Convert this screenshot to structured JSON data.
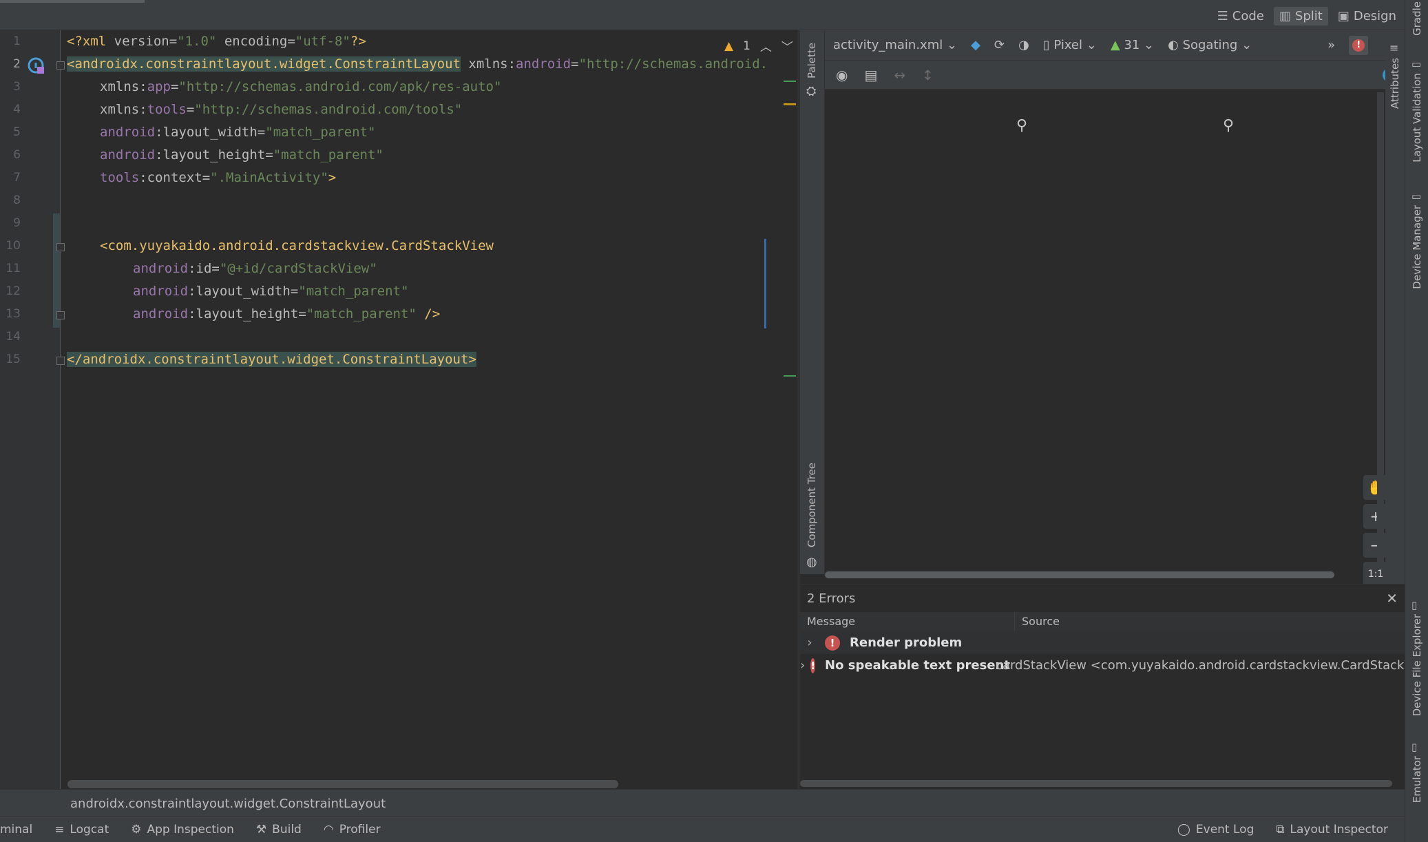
{
  "view_modes": [
    {
      "label": "Code",
      "icon": "lines-icon",
      "active": false
    },
    {
      "label": "Split",
      "icon": "split-icon",
      "active": true
    },
    {
      "label": "Design",
      "icon": "image-icon",
      "active": false
    }
  ],
  "editor": {
    "line_numbers": [
      "1",
      "2",
      "3",
      "4",
      "5",
      "6",
      "7",
      "8",
      "9",
      "10",
      "11",
      "12",
      "13",
      "14",
      "15"
    ],
    "current_line": "2",
    "warning_count": "1",
    "lines": {
      "l1": {
        "open": "<?xml ",
        "a1": "version",
        "eq1": "=",
        "v1": "\"1.0\"",
        "sp": " ",
        "a2": "encoding",
        "eq2": "=",
        "v2": "\"utf-8\"",
        "close": "?>"
      },
      "l2": {
        "tag": "<androidx.constraintlayout.widget.ConstraintLayout",
        "sp": " ",
        "a1": "xmlns:",
        "ns": "android",
        "eq": "=",
        "v": "\"http://schemas.android."
      },
      "l3": {
        "a": "xmlns:",
        "ns": "app",
        "eq": "=",
        "v": "\"http://schemas.android.com/apk/res-auto\""
      },
      "l4": {
        "a": "xmlns:",
        "ns": "tools",
        "eq": "=",
        "v": "\"http://schemas.android.com/tools\""
      },
      "l5": {
        "ns": "android",
        "a": ":layout_width",
        "eq": "=",
        "v": "\"match_parent\""
      },
      "l6": {
        "ns": "android",
        "a": ":layout_height",
        "eq": "=",
        "v": "\"match_parent\""
      },
      "l7": {
        "ns": "tools",
        "a": ":context",
        "eq": "=",
        "v": "\".MainActivity\"",
        "close": ">"
      },
      "l10": {
        "tag": "<com.yuyakaido.android.cardstackview.CardStackView"
      },
      "l11": {
        "ns": "android",
        "a": ":id",
        "eq": "=",
        "v": "\"@+id/cardStackView\""
      },
      "l12": {
        "ns": "android",
        "a": ":layout_width",
        "eq": "=",
        "v": "\"match_parent\""
      },
      "l13": {
        "ns": "android",
        "a": ":layout_height",
        "eq": "=",
        "v": "\"match_parent\"",
        "close": " />"
      },
      "l15": {
        "tag": "</androidx.constraintlayout.widget.ConstraintLayout>"
      }
    }
  },
  "design": {
    "side_palette": {
      "palette": "Palette",
      "component_tree": "Component Tree"
    },
    "toolbar": {
      "file": "activity_main.xml",
      "device": "Pixel",
      "api": "31",
      "theme": "Sogating"
    }
  },
  "errors_panel": {
    "title": "2 Errors",
    "col_message": "Message",
    "col_source": "Source",
    "rows": [
      {
        "message": "Render problem",
        "source": ""
      },
      {
        "message": "No speakable text present",
        "source": "cardStackView <com.yuyakaido.android.cardstackview.CardStackView"
      }
    ]
  },
  "right_strip": {
    "gradle": "Gradle",
    "attributes": "Attributes",
    "layout_validation": "Layout Validation",
    "device_manager": "Device Manager",
    "device_file_explorer": "Device File Explorer",
    "emulator": "Emulator"
  },
  "breadcrumb": "androidx.constraintlayout.widget.ConstraintLayout",
  "bottom_tabs": {
    "terminal": "minal",
    "logcat": "Logcat",
    "app_inspection": "App Inspection",
    "build": "Build",
    "profiler": "Profiler",
    "event_log": "Event Log",
    "layout_inspector": "Layout Inspector"
  }
}
